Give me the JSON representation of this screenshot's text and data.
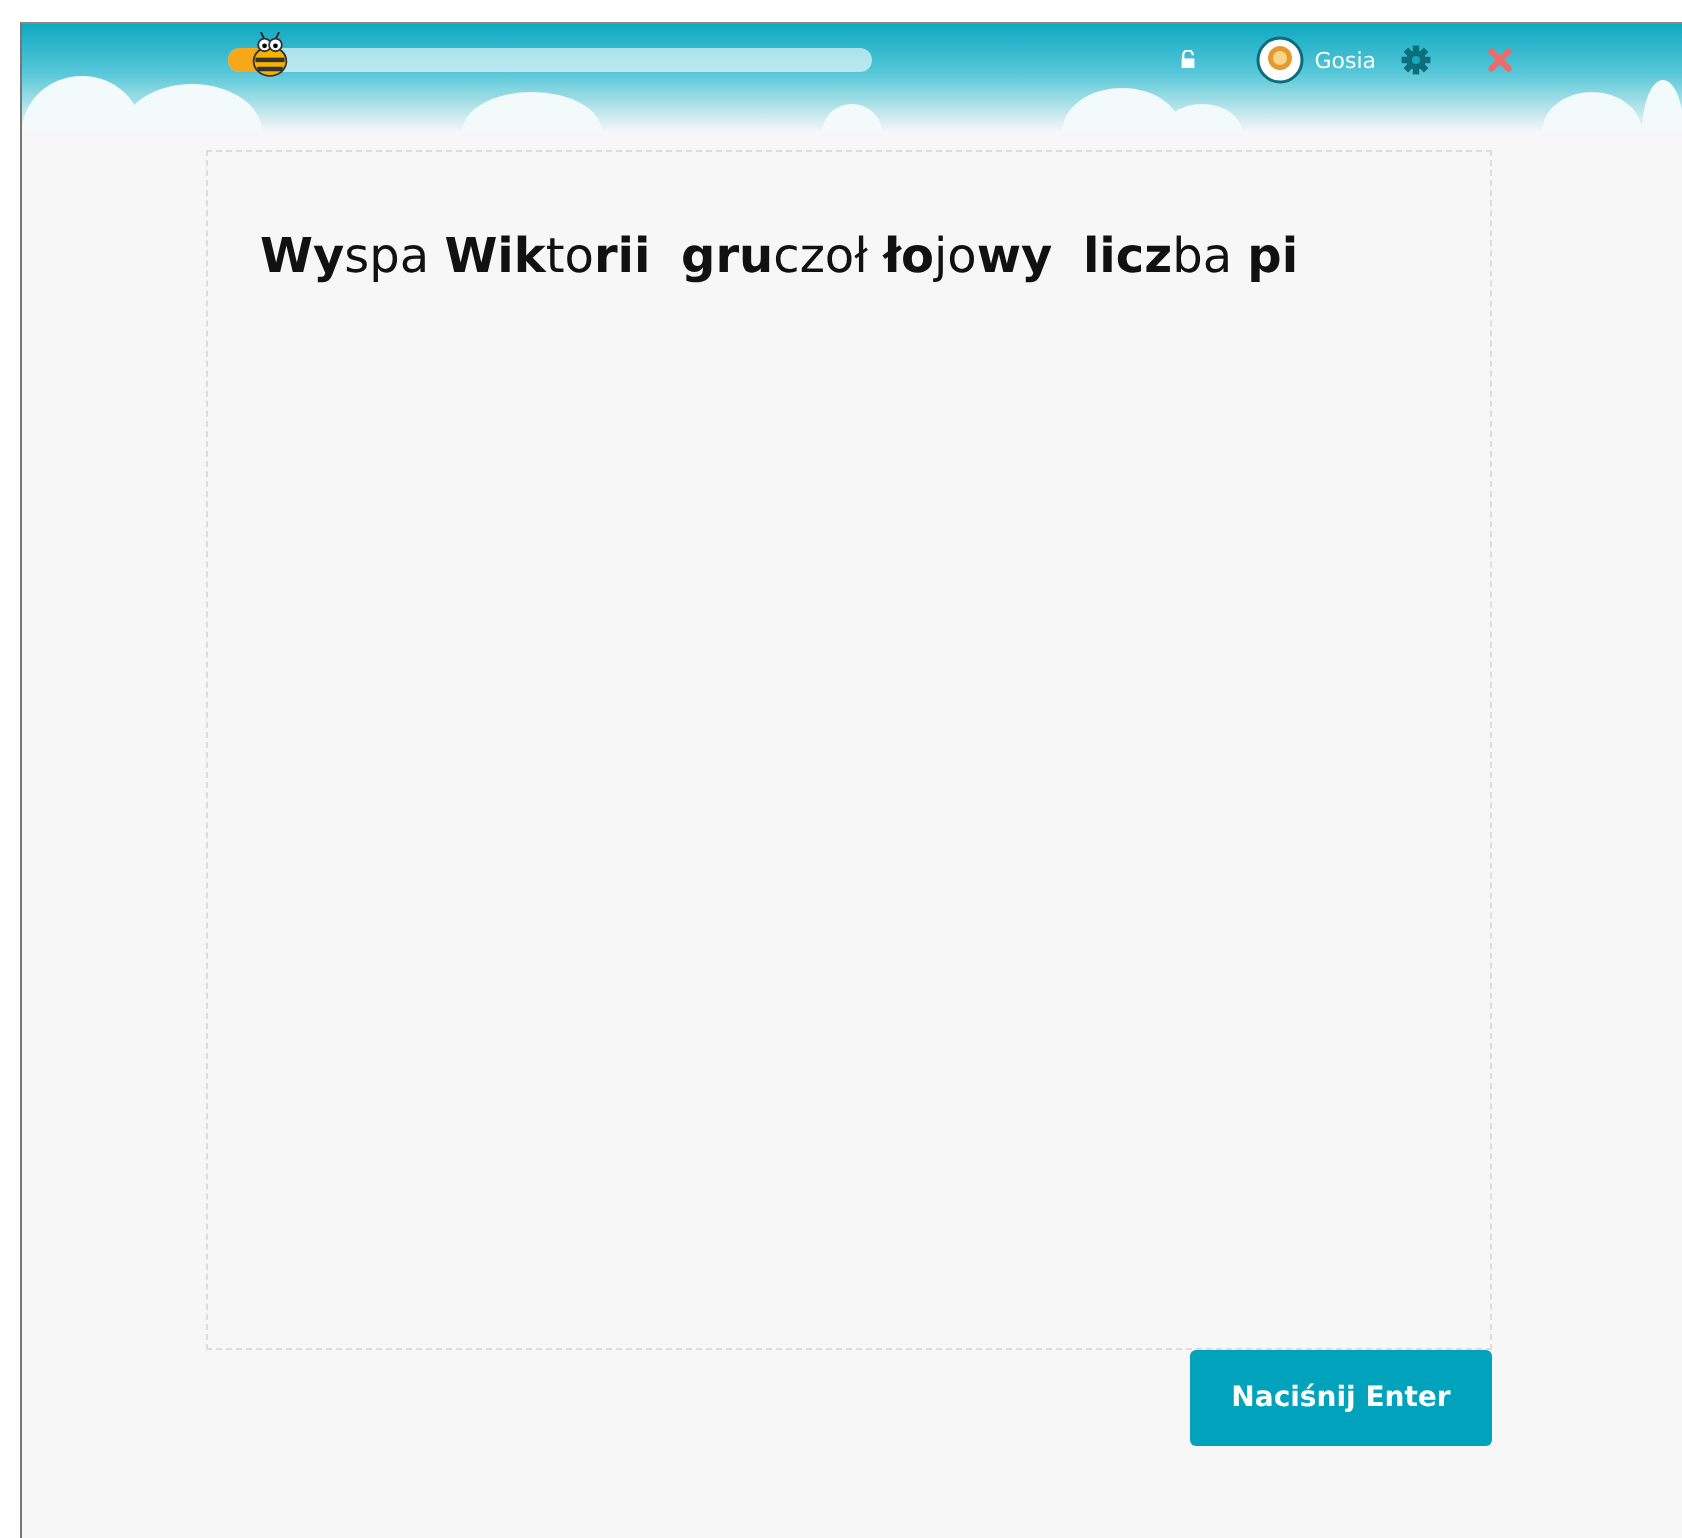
{
  "header": {
    "progress": {
      "level": 0.07
    },
    "user": {
      "name": "Gosia"
    }
  },
  "exercise": {
    "text": "**Wy**spa **Wik**to**rii**  **gru**czoł **ło**jo**wy**  **licz**ba **pi**"
  },
  "buttons": [
    {
      "label": "Naciśnij Enter"
    }
  ]
}
